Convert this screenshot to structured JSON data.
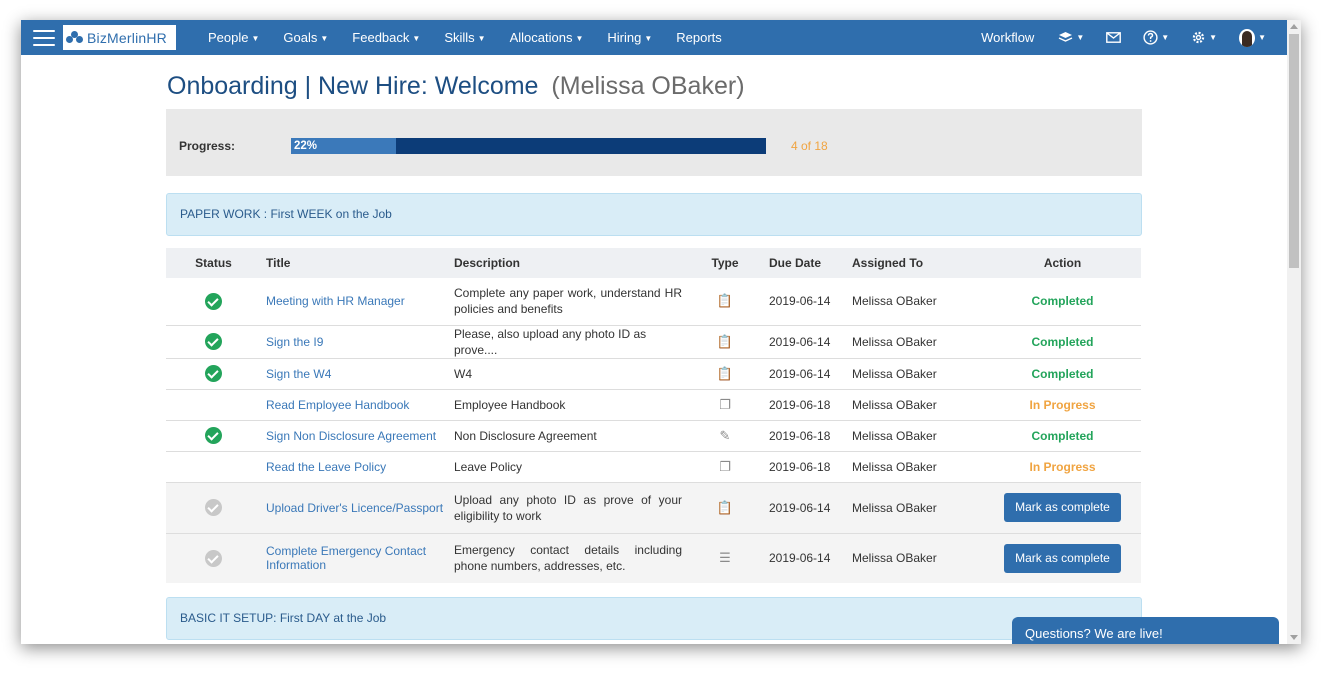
{
  "app": {
    "logo_text": "BizMerlinHR"
  },
  "nav": {
    "items": [
      {
        "label": "People",
        "caret": true
      },
      {
        "label": "Goals",
        "caret": true
      },
      {
        "label": "Feedback",
        "caret": true
      },
      {
        "label": "Skills",
        "caret": true
      },
      {
        "label": "Allocations",
        "caret": true
      },
      {
        "label": "Hiring",
        "caret": true
      },
      {
        "label": "Reports",
        "caret": false
      }
    ],
    "workflow_label": "Workflow",
    "icons": [
      "layers-icon",
      "mail-icon",
      "help-icon",
      "settings-icon",
      "user-avatar"
    ]
  },
  "page": {
    "title": "Onboarding | New Hire: Welcome",
    "subtitle": "(Melissa OBaker)"
  },
  "progress": {
    "label": "Progress:",
    "percent_text": "22%",
    "fraction": 0.22,
    "count_text": "4 of 18"
  },
  "sections": [
    {
      "prefix": "PAPER WORK : ",
      "name": "First WEEK on the Job"
    },
    {
      "prefix": "BASIC IT SETUP: ",
      "name": "First DAY at the Job"
    }
  ],
  "table": {
    "headers": {
      "status": "Status",
      "title": "Title",
      "description": "Description",
      "type": "Type",
      "due_date": "Due Date",
      "assigned_to": "Assigned To",
      "action": "Action"
    },
    "rows": [
      {
        "status": "done",
        "title": "Meeting with HR Manager",
        "description": "Complete any paper work, understand HR policies and benefits",
        "type_icon": "clipboard-check-icon",
        "due": "2019-06-14",
        "assigned": "Melissa OBaker",
        "action_kind": "completed",
        "action": "Completed"
      },
      {
        "status": "done",
        "title": "Sign the I9",
        "description": "Please, also upload any photo ID as prove....",
        "type_icon": "clipboard-list-icon",
        "due": "2019-06-14",
        "assigned": "Melissa OBaker",
        "action_kind": "completed",
        "action": "Completed"
      },
      {
        "status": "done",
        "title": "Sign the W4",
        "description": "W4",
        "type_icon": "clipboard-list-icon",
        "due": "2019-06-14",
        "assigned": "Melissa OBaker",
        "action_kind": "completed",
        "action": "Completed"
      },
      {
        "status": "none",
        "title": "Read Employee Handbook",
        "description": "Employee Handbook",
        "type_icon": "document-copy-icon",
        "due": "2019-06-18",
        "assigned": "Melissa OBaker",
        "action_kind": "progress",
        "action": "In Progress"
      },
      {
        "status": "done",
        "title": "Sign Non Disclosure Agreement",
        "description": "Non Disclosure Agreement",
        "type_icon": "edit-icon",
        "due": "2019-06-18",
        "assigned": "Melissa OBaker",
        "action_kind": "completed",
        "action": "Completed"
      },
      {
        "status": "none",
        "title": "Read the Leave Policy",
        "description": "Leave Policy",
        "type_icon": "document-copy-icon",
        "due": "2019-06-18",
        "assigned": "Melissa OBaker",
        "action_kind": "progress",
        "action": "In Progress"
      },
      {
        "status": "pending",
        "title": "Upload Driver's Licence/Passport",
        "description": "Upload any photo ID as prove of your eligibility to work",
        "type_icon": "clipboard-check-icon",
        "due": "2019-06-14",
        "assigned": "Melissa OBaker",
        "action_kind": "button",
        "action": "Mark as complete"
      },
      {
        "status": "pending",
        "title": "Complete Emergency Contact Information",
        "description": "Emergency contact details including phone numbers, addresses, etc.",
        "type_icon": "list-icon",
        "due": "2019-06-14",
        "assigned": "Melissa OBaker",
        "action_kind": "button",
        "action": "Mark as complete"
      }
    ]
  },
  "chat": {
    "label": "Questions? We are live!"
  },
  "colors": {
    "nav": "#2f6ead",
    "completed": "#23a45b",
    "in_progress": "#f0a441",
    "progress_dark": "#0c3c78",
    "progress_fill": "#3b79ba"
  }
}
